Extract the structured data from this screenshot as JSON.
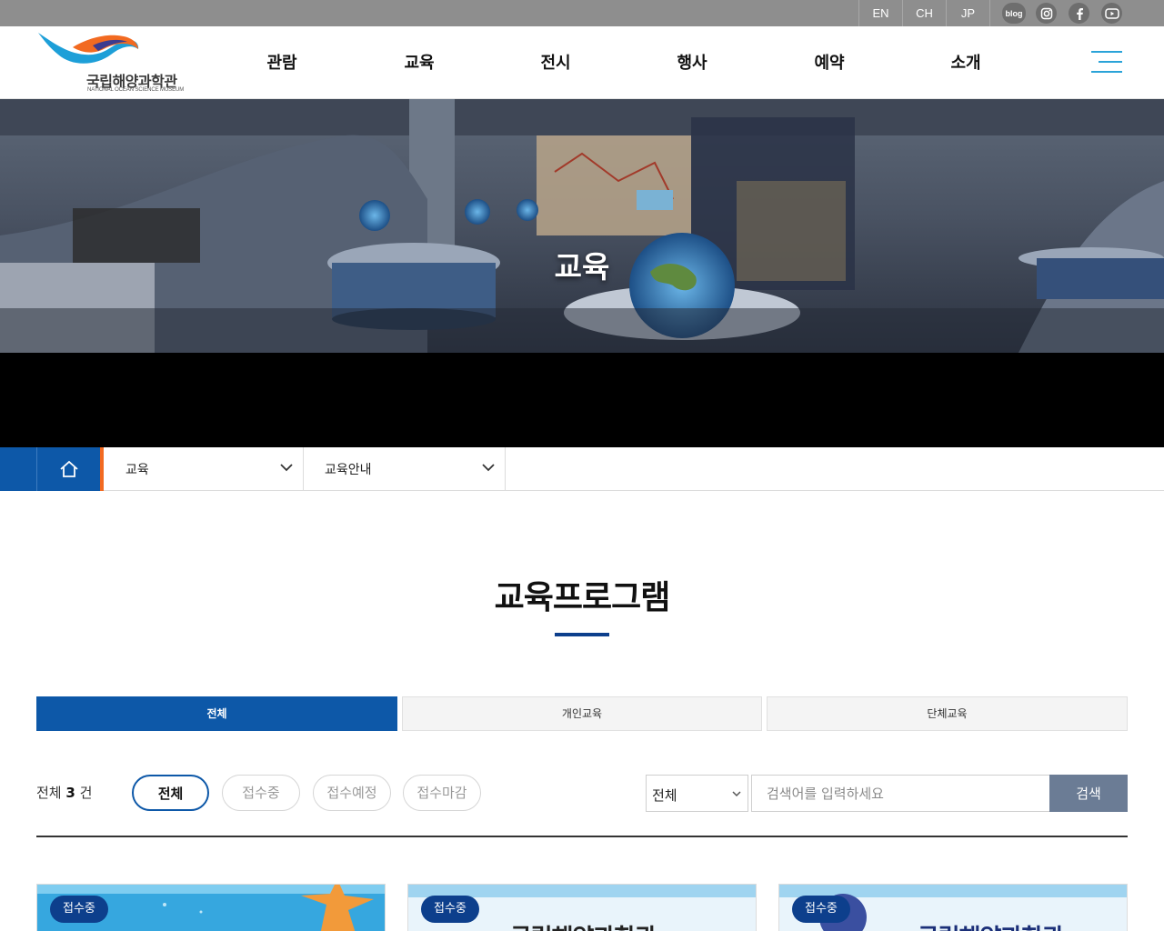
{
  "topbar": {
    "languages": [
      "EN",
      "CH",
      "JP"
    ],
    "sns": [
      {
        "name": "blog-icon",
        "label": "blog"
      },
      {
        "name": "instagram-icon",
        "label": ""
      },
      {
        "name": "facebook-icon",
        "label": ""
      },
      {
        "name": "youtube-icon",
        "label": ""
      }
    ]
  },
  "header": {
    "logo_name": "국립해양과학관",
    "logo_sub": "NATIONAL OCEAN SCIENCE MUSEUM",
    "gnb": [
      "관람",
      "교육",
      "전시",
      "행사",
      "예약",
      "소개"
    ]
  },
  "hero": {
    "title": "교육"
  },
  "breadcrumb": {
    "level1": "교육",
    "level2": "교육안내"
  },
  "main": {
    "title": "교육프로그램",
    "tabs": [
      "전체",
      "개인교육",
      "단체교육"
    ],
    "count_prefix": "전체",
    "count_value": "3",
    "count_suffix": "건",
    "filters": [
      "전체",
      "접수중",
      "접수예정",
      "접수마감"
    ],
    "search": {
      "select_value": "전체",
      "placeholder": "검색어를 입력하세요",
      "button": "검색"
    }
  },
  "cards": [
    {
      "status": "접수중",
      "text": ""
    },
    {
      "status": "접수중",
      "text": "국립해양과학관"
    },
    {
      "status": "접수중",
      "text": "국립해양과학관"
    }
  ],
  "colors": {
    "primary": "#0d58a8",
    "navy": "#0d3f8c",
    "accent_orange": "#f26a21",
    "topbar_gray": "#8e8e8e",
    "search_button": "#6b7c95"
  }
}
